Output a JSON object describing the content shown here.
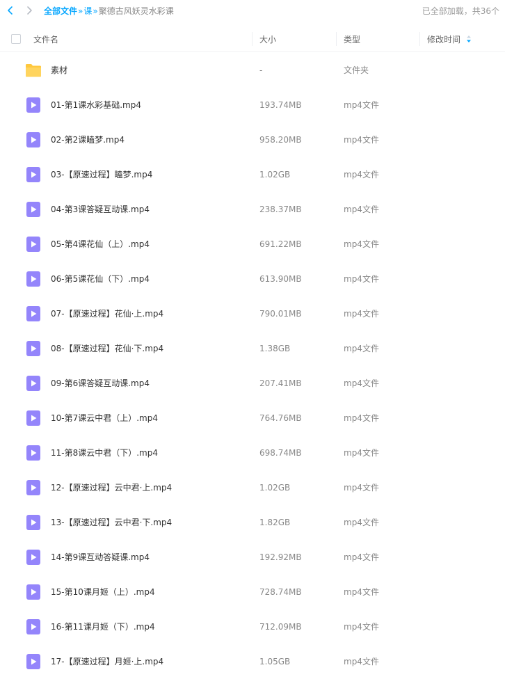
{
  "breadcrumb": {
    "root": "全部文件",
    "sep": "»",
    "middle": "课",
    "current": "聚德古风妖灵水彩课"
  },
  "status": "已全部加载，共36个",
  "columns": {
    "name": "文件名",
    "size": "大小",
    "type": "类型",
    "mtime": "修改时间"
  },
  "colors": {
    "accent": "#06a7ff",
    "video_icon": "#9485fb",
    "folder_icon": "#ffc83d"
  },
  "files": [
    {
      "icon": "folder-icon",
      "name": "素材",
      "size": "-",
      "type": "文件夹"
    },
    {
      "icon": "video-icon",
      "name": "01-第1课水彩基础.mp4",
      "size": "193.74MB",
      "type": "mp4文件"
    },
    {
      "icon": "video-icon",
      "name": "02-第2课瞌梦.mp4",
      "size": "958.20MB",
      "type": "mp4文件"
    },
    {
      "icon": "video-icon",
      "name": "03-【原速过程】瞌梦.mp4",
      "size": "1.02GB",
      "type": "mp4文件"
    },
    {
      "icon": "video-icon",
      "name": "04-第3课答疑互动课.mp4",
      "size": "238.37MB",
      "type": "mp4文件"
    },
    {
      "icon": "video-icon",
      "name": "05-第4课花仙（上）.mp4",
      "size": "691.22MB",
      "type": "mp4文件"
    },
    {
      "icon": "video-icon",
      "name": "06-第5课花仙（下）.mp4",
      "size": "613.90MB",
      "type": "mp4文件"
    },
    {
      "icon": "video-icon",
      "name": "07-【原速过程】花仙·上.mp4",
      "size": "790.01MB",
      "type": "mp4文件"
    },
    {
      "icon": "video-icon",
      "name": "08-【原速过程】花仙·下.mp4",
      "size": "1.38GB",
      "type": "mp4文件"
    },
    {
      "icon": "video-icon",
      "name": "09-第6课答疑互动课.mp4",
      "size": "207.41MB",
      "type": "mp4文件"
    },
    {
      "icon": "video-icon",
      "name": "10-第7课云中君（上）.mp4",
      "size": "764.76MB",
      "type": "mp4文件"
    },
    {
      "icon": "video-icon",
      "name": "11-第8课云中君（下）.mp4",
      "size": "698.74MB",
      "type": "mp4文件"
    },
    {
      "icon": "video-icon",
      "name": "12-【原速过程】云中君·上.mp4",
      "size": "1.02GB",
      "type": "mp4文件"
    },
    {
      "icon": "video-icon",
      "name": "13-【原速过程】云中君·下.mp4",
      "size": "1.82GB",
      "type": "mp4文件"
    },
    {
      "icon": "video-icon",
      "name": "14-第9课互动答疑课.mp4",
      "size": "192.92MB",
      "type": "mp4文件"
    },
    {
      "icon": "video-icon",
      "name": "15-第10课月姬（上）.mp4",
      "size": "728.74MB",
      "type": "mp4文件"
    },
    {
      "icon": "video-icon",
      "name": "16-第11课月姬（下）.mp4",
      "size": "712.09MB",
      "type": "mp4文件"
    },
    {
      "icon": "video-icon",
      "name": "17-【原速过程】月姬·上.mp4",
      "size": "1.05GB",
      "type": "mp4文件"
    }
  ]
}
